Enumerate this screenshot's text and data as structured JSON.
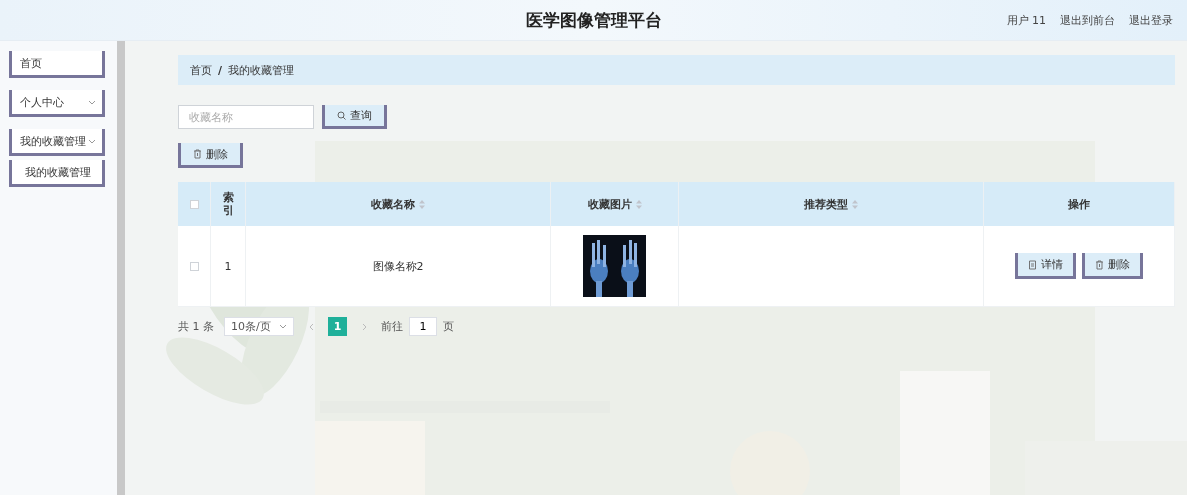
{
  "header": {
    "title": "医学图像管理平台",
    "links": [
      "用户 11",
      "退出到前台",
      "退出登录"
    ]
  },
  "sidebar": {
    "items": [
      {
        "label": "首页",
        "kind": "link"
      },
      {
        "label": "个人中心",
        "kind": "submenu"
      },
      {
        "label": "我的收藏管理",
        "kind": "submenu",
        "children": [
          {
            "label": "我的收藏管理"
          }
        ]
      }
    ]
  },
  "breadcrumb": {
    "items": [
      "首页",
      "我的收藏管理"
    ],
    "separator": "/"
  },
  "search": {
    "placeholder": "收藏名称",
    "button": "查询"
  },
  "toolbar": {
    "delete_button": "删除"
  },
  "table": {
    "select_all": {
      "checked": false
    },
    "columns": [
      {
        "label": "索引",
        "sortable": false
      },
      {
        "label": "收藏名称",
        "sortable": true
      },
      {
        "label": "收藏图片",
        "sortable": true
      },
      {
        "label": "推荐类型",
        "sortable": true
      },
      {
        "label": "操作",
        "sortable": false
      }
    ],
    "rows": [
      {
        "checked": false,
        "index": "1",
        "name": "图像名称2",
        "image": {
          "kind": "picture"
        },
        "actions": [
          "详情",
          "删除"
        ]
      }
    ]
  },
  "pagination": {
    "total": "共 1 条",
    "page_size": "10条/页",
    "pages": [
      {
        "label": "1",
        "selected": true
      }
    ],
    "goto_label": "前往",
    "goto_value": "1",
    "goto_suffix": "页"
  }
}
